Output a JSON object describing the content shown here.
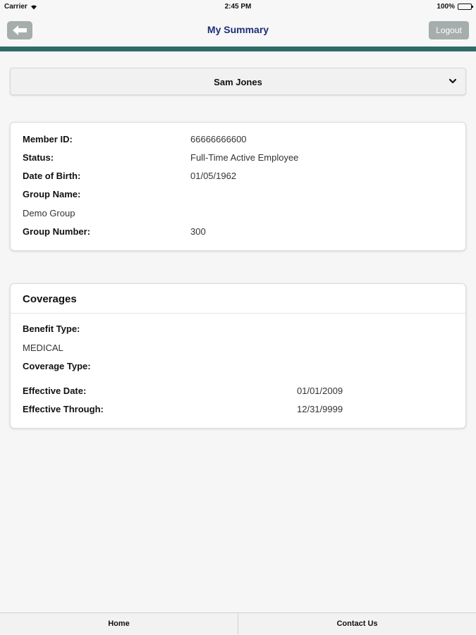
{
  "status_bar": {
    "carrier": "Carrier",
    "time": "2:45 PM",
    "battery": "100%"
  },
  "nav": {
    "title": "My Summary",
    "logout_label": "Logout"
  },
  "member_select": {
    "selected": "Sam Jones"
  },
  "member_info": {
    "member_id_label": "Member ID:",
    "member_id_value": "66666666600",
    "status_label": "Status:",
    "status_value": "Full-Time Active Employee",
    "dob_label": "Date of Birth:",
    "dob_value": "01/05/1962",
    "group_name_label": "Group Name:",
    "group_name_value": "Demo Group",
    "group_number_label": "Group Number:",
    "group_number_value": "300"
  },
  "coverages": {
    "title": "Coverages",
    "benefit_type_label": "Benefit Type:",
    "benefit_type_value": "MEDICAL",
    "coverage_type_label": "Coverage Type:",
    "effective_date_label": "Effective Date:",
    "effective_date_value": "01/01/2009",
    "effective_through_label": "Effective Through:",
    "effective_through_value": "12/31/9999"
  },
  "tabs": [
    {
      "label": "Home"
    },
    {
      "label": "Contact Us"
    }
  ],
  "colors": {
    "accent_bar": "#2e6b66",
    "title_text": "#1d2e7a",
    "button_gray": "#a5aeac"
  },
  "icons": {
    "back": "back-arrow-icon",
    "dropdown": "chevron-down-icon",
    "wifi": "wifi-icon",
    "battery": "battery-icon"
  }
}
